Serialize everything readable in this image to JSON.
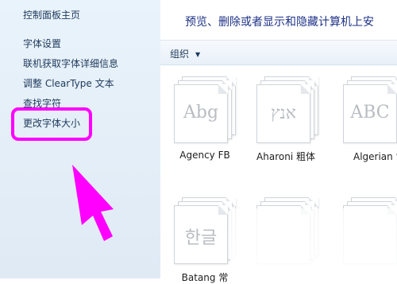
{
  "nav": {
    "home": "控制面板主页",
    "font_settings": "字体设置",
    "get_font_info": "联机获取字体详细信息",
    "cleartype": "调整 ClearType 文本",
    "find_char": "查找字符",
    "change_size": "更改字体大小"
  },
  "main": {
    "description": "预览、删除或者显示和隐藏计算机上安"
  },
  "toolbar": {
    "organize": "组织",
    "organize_arrow": "▼"
  },
  "fonts": [
    {
      "preview": "Abg",
      "name": "Agency FB"
    },
    {
      "preview": "אנץ",
      "name": "Aharoni 粗体"
    },
    {
      "preview": "ABC",
      "name": "Algerian 常"
    },
    {
      "preview": "한글",
      "name": "Batang 常"
    }
  ],
  "colors": {
    "annotation": "#ff00ff",
    "nav_background": "#e4eef8",
    "link": "#1e395b"
  }
}
